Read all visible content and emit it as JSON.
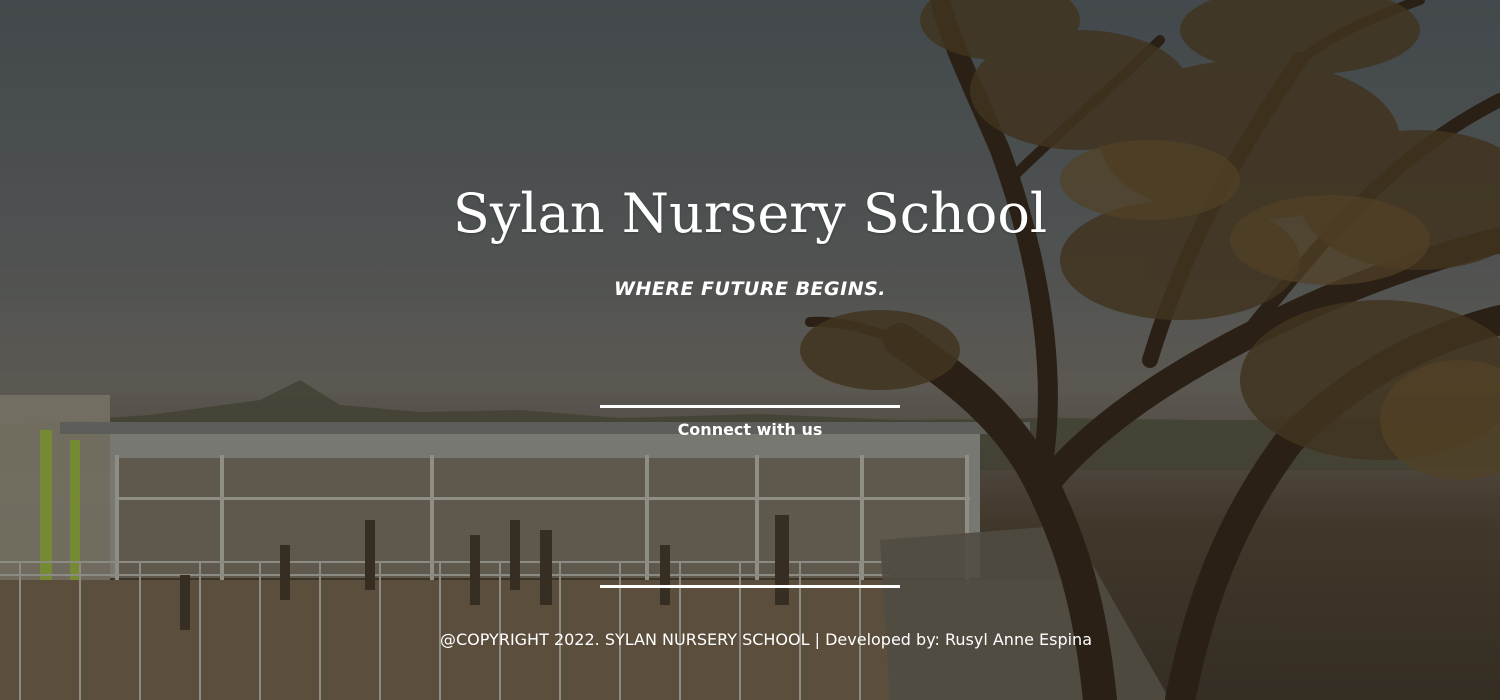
{
  "hero": {
    "title": "Sylan Nursery School",
    "tagline": "WHERE FUTURE BEGINS."
  },
  "connect": {
    "label": "Connect with us"
  },
  "footer": {
    "copyright": "@COPYRIGHT 2022. SYLAN NURSERY SCHOOL | Developed by: Rusyl Anne Espina"
  },
  "colors": {
    "text": "#ffffff",
    "sky": "#4c5358",
    "deck": "#6b5a45",
    "tree": "#3a2a18"
  }
}
